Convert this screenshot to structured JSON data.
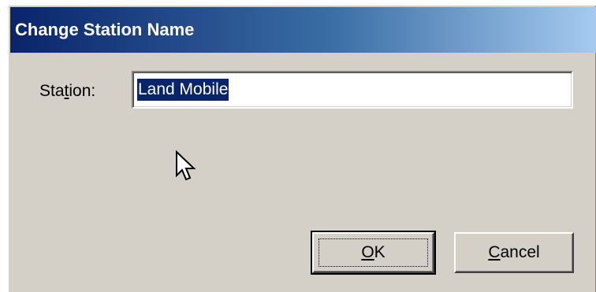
{
  "window": {
    "title": "Change Station Name"
  },
  "form": {
    "station_label_prefix": "Sta",
    "station_label_mnemonic": "t",
    "station_label_suffix": "ion:",
    "station_value": "Land Mobile"
  },
  "buttons": {
    "ok_mnemonic": "O",
    "ok_rest": "K",
    "cancel_mnemonic": "C",
    "cancel_rest": "ancel"
  },
  "colors": {
    "titlebar_start": "#0a246a",
    "titlebar_end": "#a6caf0",
    "dialog_face": "#d4d0c8",
    "selection": "#0a246a"
  },
  "icons": {
    "cursor": "mouse-pointer-icon"
  }
}
